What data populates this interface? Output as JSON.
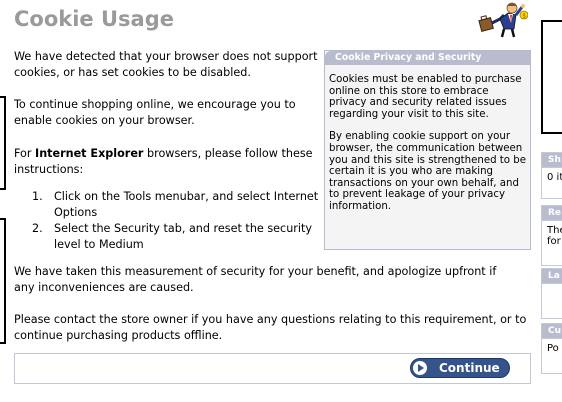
{
  "page": {
    "title": "Cookie Usage"
  },
  "main": {
    "intro": "We have detected that your browser does not support cookies, or has set cookies to be disabled.",
    "encourage": "To continue shopping online, we encourage you to enable cookies on your browser.",
    "ie_prefix": "For ",
    "ie_bold": "Internet Explorer",
    "ie_suffix": " browsers, please follow these instructions:",
    "steps": [
      {
        "num": "1.",
        "text": "Click on the Tools menubar, and select Internet Options"
      },
      {
        "num": "2.",
        "text": "Select the Security tab, and reset the security level to Medium"
      }
    ],
    "measurement": "We have taken this measurement of security for your benefit, and apologize upfront if any inconveniences are caused.",
    "contact": "Please contact the store owner if you have any questions relating to this requirement, or to continue purchasing products offline.",
    "continue_label": "Continue"
  },
  "infobox": {
    "title": "Cookie Privacy and Security",
    "para1": "Cookies must be enabled to purchase online on this store to embrace privacy and security related issues regarding your visit to this site.",
    "para2": "By enabling cookie support on your browser, the communication between you and this site is strengthened to be certain it is you who are making transactions on your own behalf, and to prevent leakage of your privacy information."
  },
  "right_column": {
    "box1_head": "Sh",
    "box1_body": "0 it",
    "box2_head": "Re",
    "box2_body": "The\nfor",
    "box3_head": "La",
    "box3_body": "",
    "box4_head": "Cu",
    "box4_body": "Po"
  },
  "colors": {
    "accent_header": "#b9bccf",
    "button": "#34548b",
    "title": "#9a9a9a"
  },
  "icons": {
    "mascot": "shopping-man-icon",
    "continue": "play-arrow-icon"
  }
}
